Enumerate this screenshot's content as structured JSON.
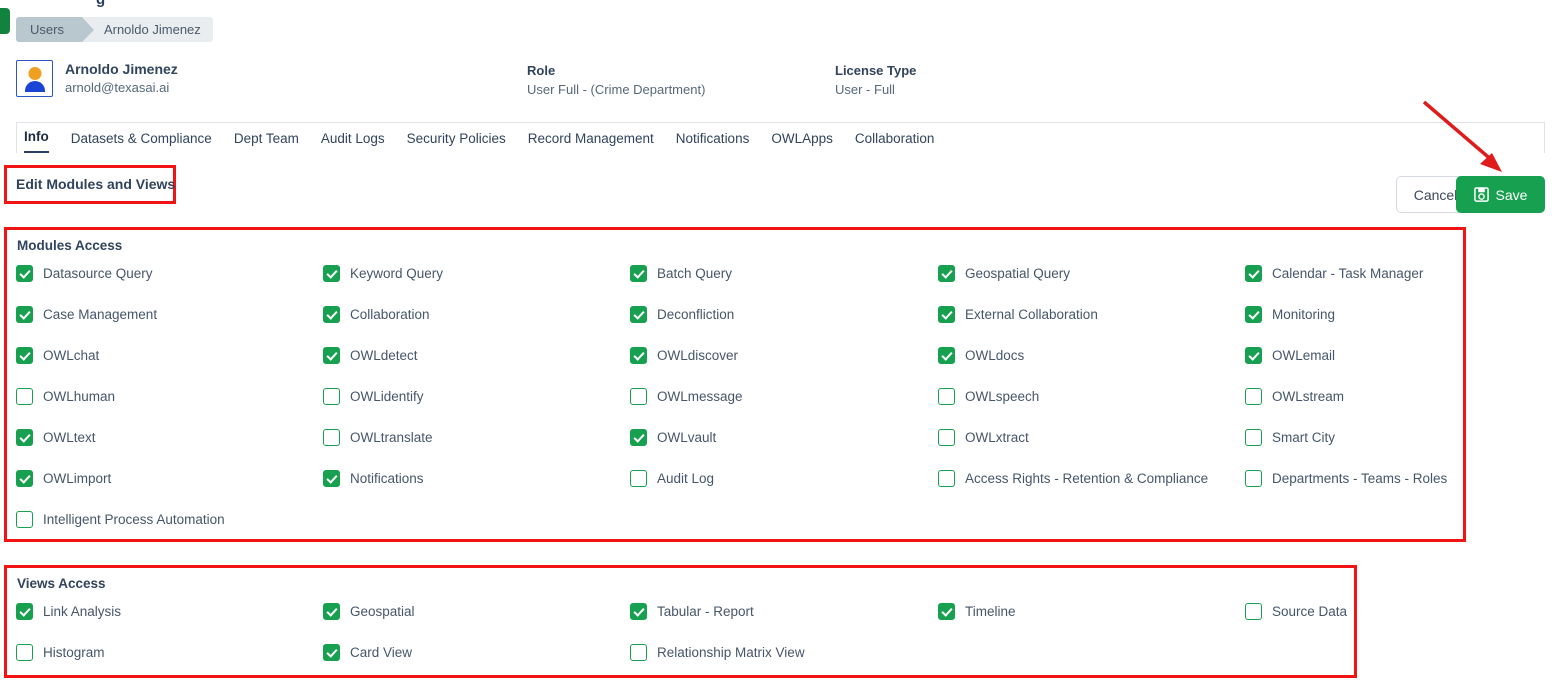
{
  "top_sliver_text": "g",
  "breadcrumb": {
    "items": [
      "Users",
      "Arnoldo Jimenez"
    ]
  },
  "user": {
    "name": "Arnoldo Jimenez",
    "email": "arnold@texasai.ai",
    "avatar_icon": "user-avatar-icon"
  },
  "fields": {
    "role_label": "Role",
    "role_value": "User Full - (Crime Department)",
    "license_label": "License Type",
    "license_value": "User - Full"
  },
  "tabs": [
    {
      "label": "Info",
      "active": true
    },
    {
      "label": "Datasets & Compliance",
      "active": false
    },
    {
      "label": "Dept Team",
      "active": false
    },
    {
      "label": "Audit Logs",
      "active": false
    },
    {
      "label": "Security Policies",
      "active": false
    },
    {
      "label": "Record Management",
      "active": false
    },
    {
      "label": "Notifications",
      "active": false
    },
    {
      "label": "OWLApps",
      "active": false
    },
    {
      "label": "Collaboration",
      "active": false
    }
  ],
  "editor": {
    "title": "Edit Modules and Views",
    "cancel_label": "Cancel",
    "save_label": "Save",
    "save_icon": "floppy-disk-save-icon"
  },
  "modules_access": {
    "title": "Modules Access",
    "items": [
      {
        "label": "Datasource Query",
        "checked": true,
        "col": 0,
        "row": 0
      },
      {
        "label": "Keyword Query",
        "checked": true,
        "col": 1,
        "row": 0
      },
      {
        "label": "Batch Query",
        "checked": true,
        "col": 2,
        "row": 0
      },
      {
        "label": "Geospatial Query",
        "checked": true,
        "col": 3,
        "row": 0
      },
      {
        "label": "Calendar - Task Manager",
        "checked": true,
        "col": 4,
        "row": 0
      },
      {
        "label": "Case Management",
        "checked": true,
        "col": 0,
        "row": 1
      },
      {
        "label": "Collaboration",
        "checked": true,
        "col": 1,
        "row": 1
      },
      {
        "label": "Deconfliction",
        "checked": true,
        "col": 2,
        "row": 1
      },
      {
        "label": "External Collaboration",
        "checked": true,
        "col": 3,
        "row": 1
      },
      {
        "label": "Monitoring",
        "checked": true,
        "col": 4,
        "row": 1
      },
      {
        "label": "OWLchat",
        "checked": true,
        "col": 0,
        "row": 2
      },
      {
        "label": "OWLdetect",
        "checked": true,
        "col": 1,
        "row": 2
      },
      {
        "label": "OWLdiscover",
        "checked": true,
        "col": 2,
        "row": 2
      },
      {
        "label": "OWLdocs",
        "checked": true,
        "col": 3,
        "row": 2
      },
      {
        "label": "OWLemail",
        "checked": true,
        "col": 4,
        "row": 2
      },
      {
        "label": "OWLhuman",
        "checked": false,
        "col": 0,
        "row": 3
      },
      {
        "label": "OWLidentify",
        "checked": false,
        "col": 1,
        "row": 3
      },
      {
        "label": "OWLmessage",
        "checked": false,
        "col": 2,
        "row": 3
      },
      {
        "label": "OWLspeech",
        "checked": false,
        "col": 3,
        "row": 3
      },
      {
        "label": "OWLstream",
        "checked": false,
        "col": 4,
        "row": 3
      },
      {
        "label": "OWLtext",
        "checked": true,
        "col": 0,
        "row": 4
      },
      {
        "label": "OWLtranslate",
        "checked": false,
        "col": 1,
        "row": 4
      },
      {
        "label": "OWLvault",
        "checked": true,
        "col": 2,
        "row": 4
      },
      {
        "label": "OWLxtract",
        "checked": false,
        "col": 3,
        "row": 4
      },
      {
        "label": "Smart City",
        "checked": false,
        "col": 4,
        "row": 4
      },
      {
        "label": "OWLimport",
        "checked": true,
        "col": 0,
        "row": 5
      },
      {
        "label": "Notifications",
        "checked": true,
        "col": 1,
        "row": 5
      },
      {
        "label": "Audit Log",
        "checked": false,
        "col": 2,
        "row": 5
      },
      {
        "label": "Access Rights - Retention & Compliance",
        "checked": false,
        "col": 3,
        "row": 5
      },
      {
        "label": "Departments - Teams - Roles",
        "checked": false,
        "col": 4,
        "row": 5
      },
      {
        "label": "Intelligent Process Automation",
        "checked": false,
        "col": 0,
        "row": 6
      }
    ]
  },
  "views_access": {
    "title": "Views Access",
    "items": [
      {
        "label": "Link Analysis",
        "checked": true,
        "col": 0,
        "row": 0
      },
      {
        "label": "Geospatial",
        "checked": true,
        "col": 1,
        "row": 0
      },
      {
        "label": "Tabular - Report",
        "checked": true,
        "col": 2,
        "row": 0
      },
      {
        "label": "Timeline",
        "checked": true,
        "col": 3,
        "row": 0
      },
      {
        "label": "Source Data",
        "checked": false,
        "col": 4,
        "row": 0
      },
      {
        "label": "Histogram",
        "checked": false,
        "col": 0,
        "row": 1
      },
      {
        "label": "Card View",
        "checked": true,
        "col": 1,
        "row": 1
      },
      {
        "label": "Relationship Matrix View",
        "checked": false,
        "col": 2,
        "row": 1
      }
    ]
  },
  "colors": {
    "accent_green": "#17a04f",
    "annotation_red": "#f01414",
    "text_dark": "#31445c",
    "text_muted": "#56687c"
  }
}
